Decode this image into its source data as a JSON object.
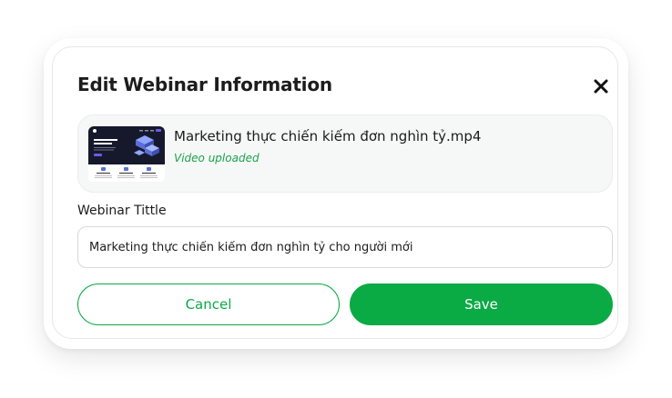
{
  "modal": {
    "title": "Edit Webinar Information"
  },
  "file": {
    "name": "Marketing thực chiến kiếm đơn nghìn tỷ.mp4",
    "status": "Video uploaded",
    "thumbnail_headline": "Where Creativity Meets Innovation"
  },
  "form": {
    "title_label": "Webinar Tittle",
    "title_value": "Marketing thực chiến kiếm đơn nghìn tỷ cho người mới"
  },
  "actions": {
    "cancel_label": "Cancel",
    "save_label": "Save"
  },
  "icons": {
    "close": "close-icon"
  },
  "colors": {
    "accent": "#0aaa45",
    "status_text": "#1aa34a",
    "title_text": "#1c1c1c"
  }
}
